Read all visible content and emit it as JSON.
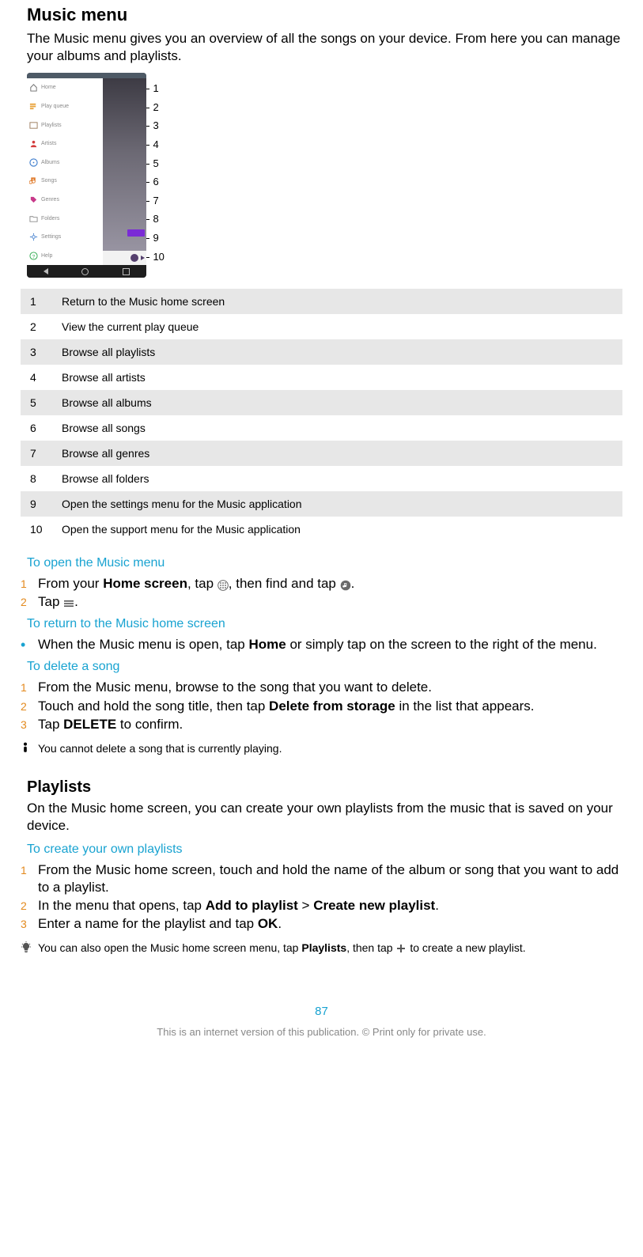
{
  "section1": {
    "title": "Music menu",
    "intro": "The Music menu gives you an overview of all the songs on your device. From here you can manage your albums and playlists."
  },
  "drawer_items": [
    {
      "label": "Home"
    },
    {
      "label": "Play queue"
    },
    {
      "label": "Playlists"
    },
    {
      "label": "Artists"
    },
    {
      "label": "Albums"
    },
    {
      "label": "Songs"
    },
    {
      "label": "Genres"
    },
    {
      "label": "Folders"
    },
    {
      "label": "Settings"
    },
    {
      "label": "Help"
    }
  ],
  "callouts": [
    "1",
    "2",
    "3",
    "4",
    "5",
    "6",
    "7",
    "8",
    "9",
    "10"
  ],
  "ref_table": [
    {
      "n": "1",
      "t": "Return to the Music home screen"
    },
    {
      "n": "2",
      "t": "View the current play queue"
    },
    {
      "n": "3",
      "t": "Browse all playlists"
    },
    {
      "n": "4",
      "t": "Browse all artists"
    },
    {
      "n": "5",
      "t": "Browse all albums"
    },
    {
      "n": "6",
      "t": "Browse all songs"
    },
    {
      "n": "7",
      "t": "Browse all genres"
    },
    {
      "n": "8",
      "t": "Browse all folders"
    },
    {
      "n": "9",
      "t": "Open the settings menu for the Music application"
    },
    {
      "n": "10",
      "t": "Open the support menu for the Music application"
    }
  ],
  "open_menu": {
    "heading": "To open the Music menu",
    "s1_a": "From your ",
    "s1_b": "Home screen",
    "s1_c": ", tap ",
    "s1_d": ", then find and tap ",
    "s1_e": ".",
    "s2_a": "Tap ",
    "s2_b": "."
  },
  "return_home": {
    "heading": "To return to the Music home screen",
    "b_a": "When the Music menu is open, tap ",
    "b_b": "Home",
    "b_c": " or simply tap on the screen to the right of the menu."
  },
  "delete_song": {
    "heading": "To delete a song",
    "s1": "From the Music menu, browse to the song that you want to delete.",
    "s2_a": "Touch and hold the song title, then tap ",
    "s2_b": "Delete from storage",
    "s2_c": " in the list that appears.",
    "s3_a": "Tap ",
    "s3_b": "DELETE",
    "s3_c": " to confirm.",
    "note": "You cannot delete a song that is currently playing."
  },
  "playlists": {
    "title": "Playlists",
    "intro": "On the Music home screen, you can create your own playlists from the music that is saved on your device.",
    "heading": "To create your own playlists",
    "s1": "From the Music home screen, touch and hold the name of the album or song that you want to add to a playlist.",
    "s2_a": "In the menu that opens, tap ",
    "s2_b": "Add to playlist",
    "s2_c": " > ",
    "s2_d": "Create new playlist",
    "s2_e": ".",
    "s3_a": "Enter a name for the playlist and tap ",
    "s3_b": "OK",
    "s3_c": ".",
    "tip_a": "You can also open the Music home screen menu, tap ",
    "tip_b": "Playlists",
    "tip_c": ", then tap ",
    "tip_d": " to create a new playlist."
  },
  "page_number": "87",
  "footer": "This is an internet version of this publication. © Print only for private use."
}
